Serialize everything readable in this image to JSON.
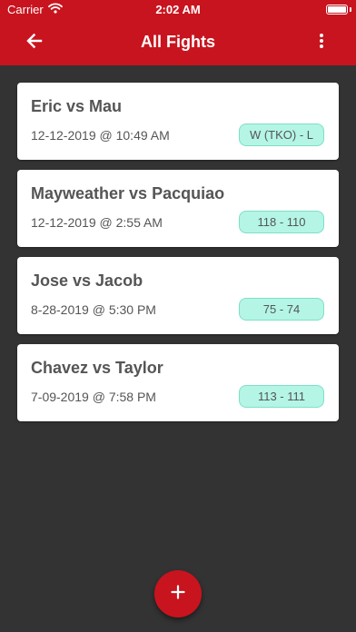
{
  "status_bar": {
    "carrier": "Carrier",
    "time": "2:02 AM"
  },
  "nav": {
    "title": "All Fights",
    "back_icon": "arrow-left-icon",
    "menu_icon": "more-vertical-icon"
  },
  "fights": [
    {
      "title": "Eric vs Mau",
      "date": "12-12-2019 @ 10:49 AM",
      "score": "W (TKO) - L"
    },
    {
      "title": "Mayweather vs Pacquiao",
      "date": "12-12-2019 @ 2:55 AM",
      "score": "118 - 110"
    },
    {
      "title": "Jose vs Jacob",
      "date": "8-28-2019 @ 5:30 PM",
      "score": "75 - 74"
    },
    {
      "title": "Chavez vs Taylor",
      "date": "7-09-2019 @ 7:58 PM",
      "score": "113 - 111"
    }
  ],
  "fab": {
    "icon": "plus-icon"
  },
  "colors": {
    "primary": "#c8141e",
    "background": "#333333",
    "card": "#ffffff",
    "score_badge": "#b4f5e6",
    "score_badge_border": "#7ce0c6",
    "text": "#555555"
  }
}
